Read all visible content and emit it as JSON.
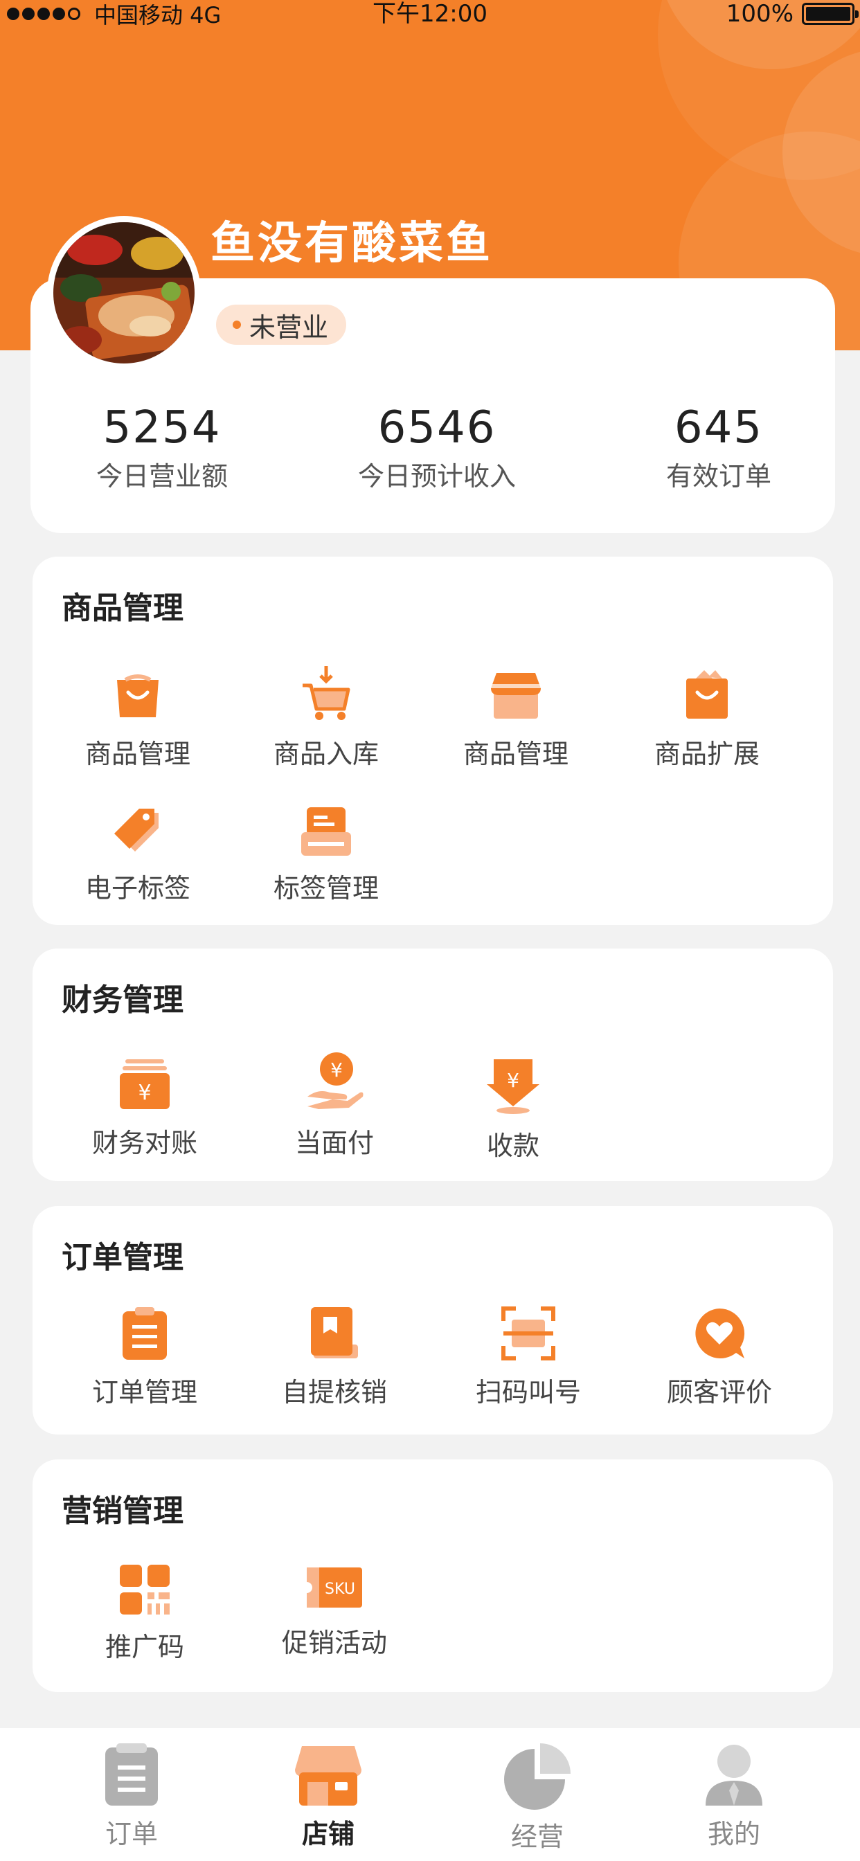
{
  "status_bar": {
    "carrier": "中国移动 4G",
    "time": "下午12:00",
    "battery": "100%"
  },
  "store": {
    "name": "鱼没有酸菜鱼",
    "status": "未营业"
  },
  "stats": [
    {
      "value": "5254",
      "label": "今日营业额"
    },
    {
      "value": "6546",
      "label": "今日预计收入"
    },
    {
      "value": "645",
      "label": "有效订单"
    }
  ],
  "sections": {
    "goods": {
      "title": "商品管理",
      "items": [
        {
          "label": "商品管理",
          "icon": "shopping-bag-icon"
        },
        {
          "label": "商品入库",
          "icon": "cart-inbound-icon"
        },
        {
          "label": "商品管理",
          "icon": "storefront-icon"
        },
        {
          "label": "商品扩展",
          "icon": "gift-bag-icon"
        },
        {
          "label": "电子标签",
          "icon": "tag-icon"
        },
        {
          "label": "标签管理",
          "icon": "label-printer-icon"
        }
      ]
    },
    "finance": {
      "title": "财务管理",
      "items": [
        {
          "label": "财务对账",
          "icon": "ledger-icon"
        },
        {
          "label": "当面付",
          "icon": "hand-pay-icon"
        },
        {
          "label": "收款",
          "icon": "receive-money-icon"
        }
      ]
    },
    "orders": {
      "title": "订单管理",
      "items": [
        {
          "label": "订单管理",
          "icon": "clipboard-icon"
        },
        {
          "label": "自提核销",
          "icon": "bookmark-book-icon"
        },
        {
          "label": "扫码叫号",
          "icon": "scan-icon"
        },
        {
          "label": "顾客评价",
          "icon": "heart-chat-icon"
        }
      ]
    },
    "marketing": {
      "title": "营销管理",
      "items": [
        {
          "label": "推广码",
          "icon": "qr-code-icon"
        },
        {
          "label": "促销活动",
          "icon": "sku-ticket-icon"
        }
      ]
    }
  },
  "tabbar": {
    "tabs": [
      {
        "label": "订单",
        "icon": "order-list-icon",
        "active": false
      },
      {
        "label": "店铺",
        "icon": "shop-icon",
        "active": true
      },
      {
        "label": "经营",
        "icon": "pie-chart-icon",
        "active": false
      },
      {
        "label": "我的",
        "icon": "user-icon",
        "active": false
      }
    ]
  },
  "colors": {
    "accent": "#f48029",
    "accent_light": "#f9b48a",
    "background": "#f2f2f2"
  }
}
